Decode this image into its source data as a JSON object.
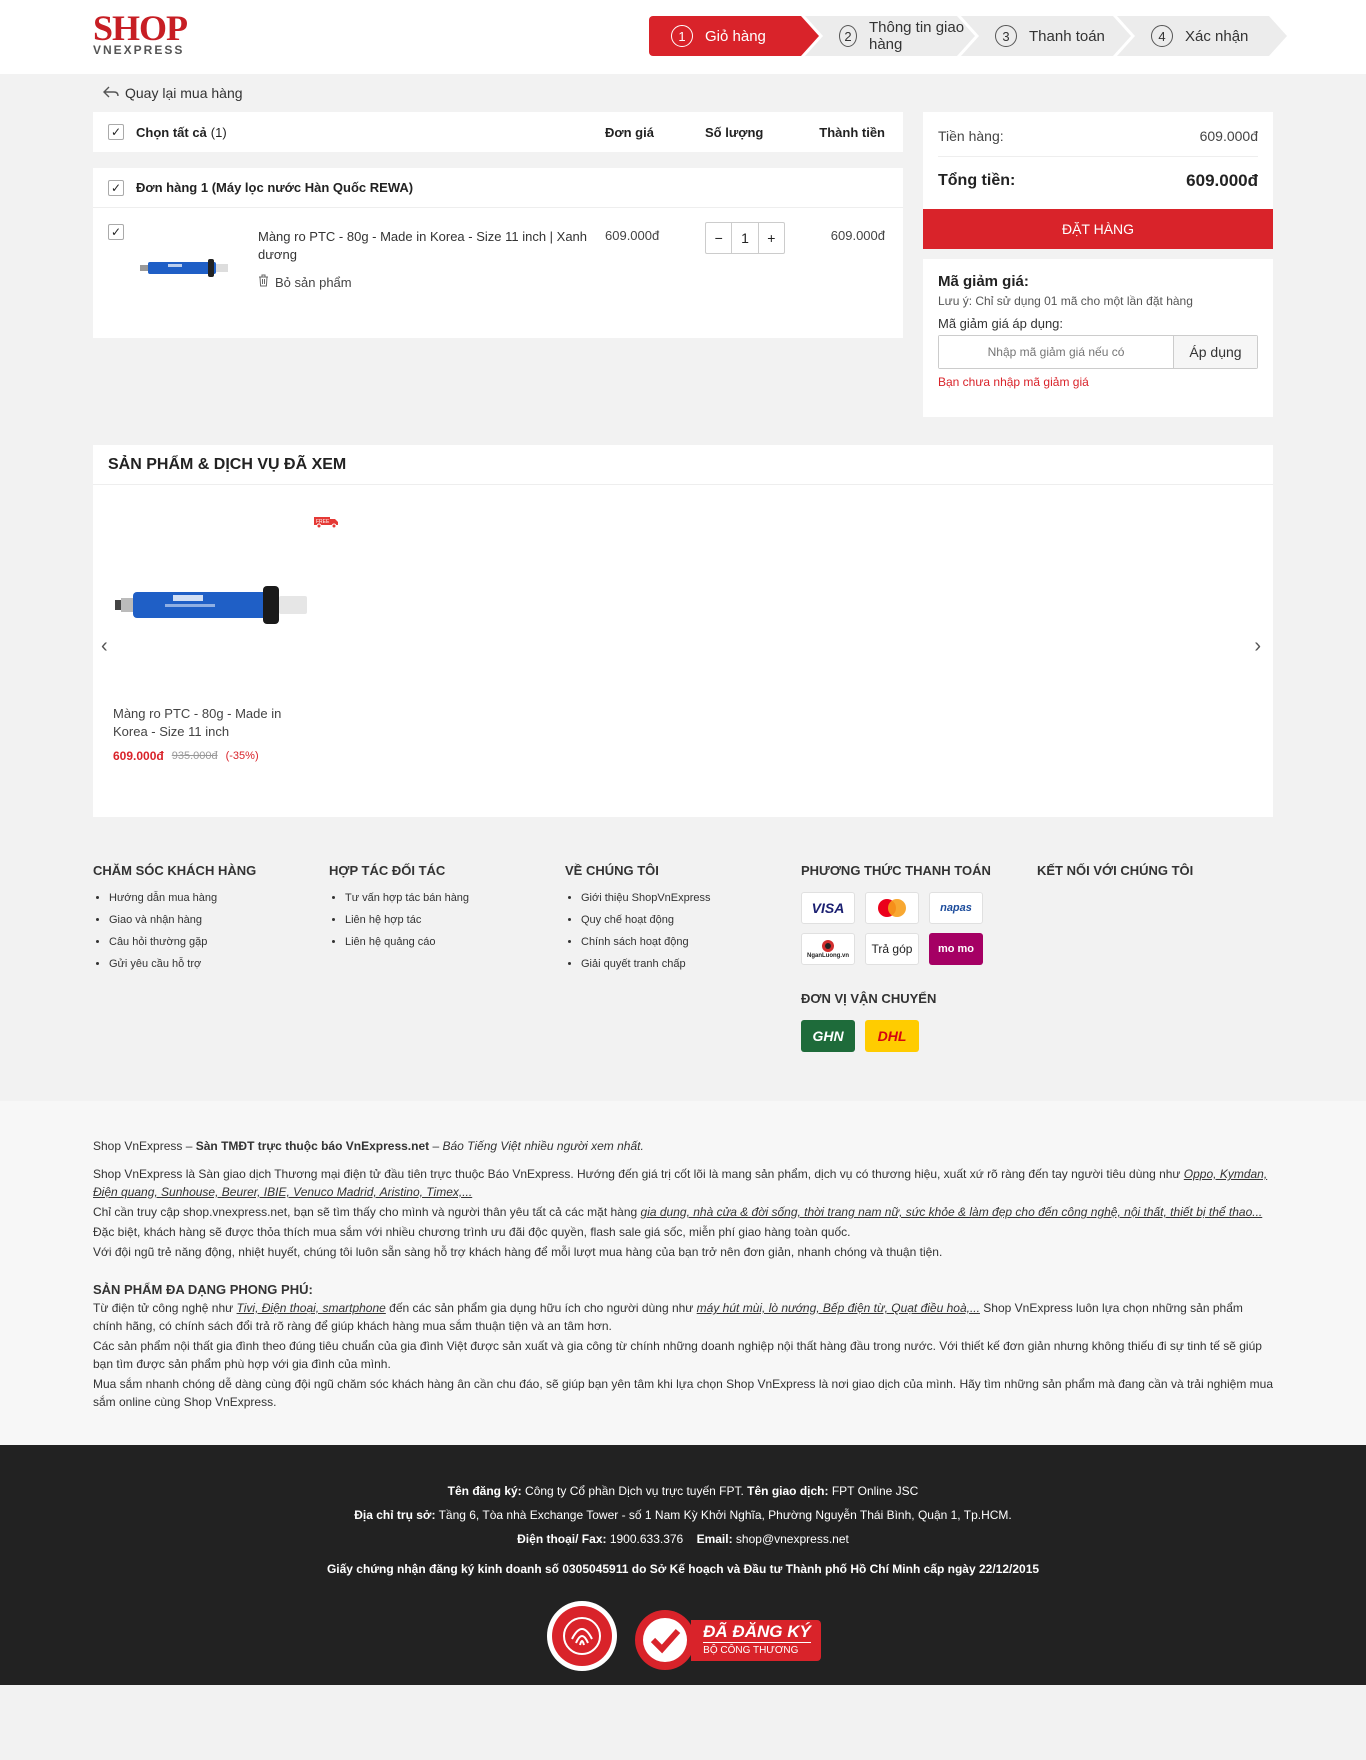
{
  "logo": {
    "top": "SHOP",
    "bottom": "VNEXPRESS"
  },
  "steps": [
    {
      "num": "1",
      "label": "Giỏ hàng"
    },
    {
      "num": "2",
      "label": "Thông tin giao hàng"
    },
    {
      "num": "3",
      "label": "Thanh toán"
    },
    {
      "num": "4",
      "label": "Xác nhận"
    }
  ],
  "back_label": "Quay lại mua hàng",
  "table": {
    "select_all": "Chọn tất cả",
    "count": "(1)",
    "col_price": "Đơn giá",
    "col_qty": "Số lượng",
    "col_total": "Thành tiền"
  },
  "order": {
    "title": "Đơn hàng 1 (Máy lọc nước Hàn Quốc REWA)",
    "item": {
      "name": "Màng ro PTC - 80g - Made in Korea - Size 11 inch | Xanh dương",
      "remove": "Bỏ sản phẩm",
      "price": "609.000đ",
      "qty": "1",
      "total": "609.000đ"
    }
  },
  "summary": {
    "subtotal_label": "Tiền hàng:",
    "subtotal": "609.000đ",
    "total_label": "Tổng tiền:",
    "total": "609.000đ",
    "button": "ĐẶT HÀNG"
  },
  "coupon": {
    "title": "Mã giảm giá:",
    "note": "Lưu ý: Chỉ sử dụng 01 mã cho một lần đặt hàng",
    "label": "Mã giảm giá áp dụng:",
    "placeholder": "Nhập mã giảm giá nếu có",
    "apply": "Áp dụng",
    "error": "Bạn chưa nhập mã giảm giá"
  },
  "viewed": {
    "title": "SẢN PHẨM & DỊCH VỤ ĐÃ XEM",
    "product": {
      "title": "Màng ro PTC - 80g - Made in Korea - Size 11 inch",
      "price": "609.000đ",
      "old_price": "935.000đ",
      "discount": "(-35%)",
      "free_badge": "FREE"
    }
  },
  "footer": {
    "care": {
      "title": "CHĂM SÓC KHÁCH HÀNG",
      "items": [
        "Hướng dẫn mua hàng",
        "Giao và nhận hàng",
        "Câu hỏi thường gặp",
        "Gửi yêu cầu hỗ trợ"
      ]
    },
    "partner": {
      "title": "HỢP TÁC ĐỐI TÁC",
      "items": [
        "Tư vấn hợp tác bán hàng",
        "Liên hệ hợp tác",
        "Liên hệ quảng cáo"
      ]
    },
    "about": {
      "title": "VỀ CHÚNG TÔI",
      "items": [
        "Giới thiệu ShopVnExpress",
        "Quy chế hoạt động",
        "Chính sách hoạt động",
        "Giải quyết tranh chấp"
      ]
    },
    "payment": {
      "title": "PHƯƠNG THỨC THANH TOÁN",
      "visa": "VISA",
      "napas": "napas",
      "nganluong": "NganLuong.vn",
      "installment": "Trả góp",
      "momo": "mo mo"
    },
    "shipping": {
      "title": "ĐƠN VỊ VẬN CHUYỂN",
      "ghn": "GHN",
      "dhl": "DHL"
    },
    "connect": {
      "title": "KẾT NỐI VỚI CHÚNG TÔI"
    }
  },
  "about_text": {
    "l1_a": "Shop VnExpress – ",
    "l1_b": "Sàn TMĐT trực thuộc báo VnExpress.net",
    "l1_c": " – ",
    "l1_d": "Báo Tiếng Việt nhiều người xem nhất.",
    "p1": "Shop VnExpress là Sàn giao dịch Thương mại điện tử đầu tiên trực thuộc Báo VnExpress. Hướng đến giá trị cốt lõi là mang sản phẩm, dịch vụ có thương hiệu, xuất xứ rõ ràng đến tay người tiêu dùng như ",
    "p1_link": "Oppo, Kymdan, Điện quang, Sunhouse, Beurer, IBIE, Venuco Madrid, Aristino, Timex,...",
    "p2": "Chỉ cần truy cập shop.vnexpress.net, bạn sẽ tìm thấy cho mình và người thân yêu tất cả các mặt hàng ",
    "p2_link": "gia dụng, nhà cửa & đời sống, thời trang nam nữ, sức khỏe & làm đẹp cho đến công nghệ, nội thất, thiết bị thể thao...",
    "p3": "Đặc biệt, khách hàng sẽ được thỏa thích mua sắm với nhiều chương trình ưu đãi độc quyền, flash sale giá sốc, miễn phí giao hàng toàn quốc.",
    "p4": "Với đội ngũ trẻ năng động, nhiệt huyết, chúng tôi luôn sẵn sàng hỗ trợ khách hàng để mỗi lượt mua hàng của bạn trở nên đơn giản, nhanh chóng và thuận tiện.",
    "h2": "SẢN PHẨM ĐA DẠNG PHONG PHÚ:",
    "q1_a": "Từ điện tử công nghệ như ",
    "q1_l1": "Tivi, Điện thoại, smartphone",
    "q1_b": " đến các sản phẩm gia dụng hữu ích cho người dùng như ",
    "q1_l2": "máy hút mùi, lò nướng, Bếp điện từ, Quạt điều hoà,...",
    "q1_c": " Shop VnExpress luôn lựa chọn những sản phẩm chính hãng, có chính sách đổi trả rõ ràng để giúp khách hàng mua sắm thuận tiện và an tâm hơn.",
    "q2": "Các sản phẩm nội thất gia đình theo đúng tiêu chuẩn của gia đình Việt được sản xuất và gia công từ chính những doanh nghiệp nội thất hàng đầu trong nước. Với thiết kế đơn giản nhưng không thiếu đi sự tinh tế sẽ giúp bạn tìm được sản phẩm phù hợp với gia đình của mình.",
    "q3": "Mua sắm nhanh chóng dễ dàng cùng đội ngũ chăm sóc khách hàng ân cần chu đáo, sẽ giúp bạn yên tâm khi lựa chọn Shop VnExpress là nơi giao dịch của mình. Hãy tìm những sản phẩm mà đang cần và trải nghiệm mua sắm online cùng Shop VnExpress."
  },
  "legal": {
    "reg_label": "Tên đăng ký:",
    "reg_value": " Công ty Cổ phần Dịch vụ trực tuyến FPT. ",
    "trade_label": "Tên giao dịch:",
    "trade_value": " FPT Online JSC",
    "addr_label": "Địa chỉ trụ sở:",
    "addr_value": " Tầng 6, Tòa nhà Exchange Tower - số 1 Nam Kỳ Khởi Nghĩa, Phường Nguyễn Thái Bình, Quận 1, Tp.HCM.",
    "phone_label": "Điện thoại/ Fax:",
    "phone_value": " 1900.633.376",
    "email_label": "Email:",
    "email_value": " shop@vnexpress.net",
    "license": "Giấy chứng nhận đăng ký kinh doanh số 0305045911 do Sở Kế hoạch và Đầu tư Thành phố Hồ Chí Minh cấp ngày 22/12/2015",
    "badge_main": "ĐÃ ĐĂNG KÝ",
    "badge_sub": "BỘ CÔNG THƯƠNG"
  },
  "colors": {
    "brand": "#d9232a",
    "dark": "#222222"
  }
}
